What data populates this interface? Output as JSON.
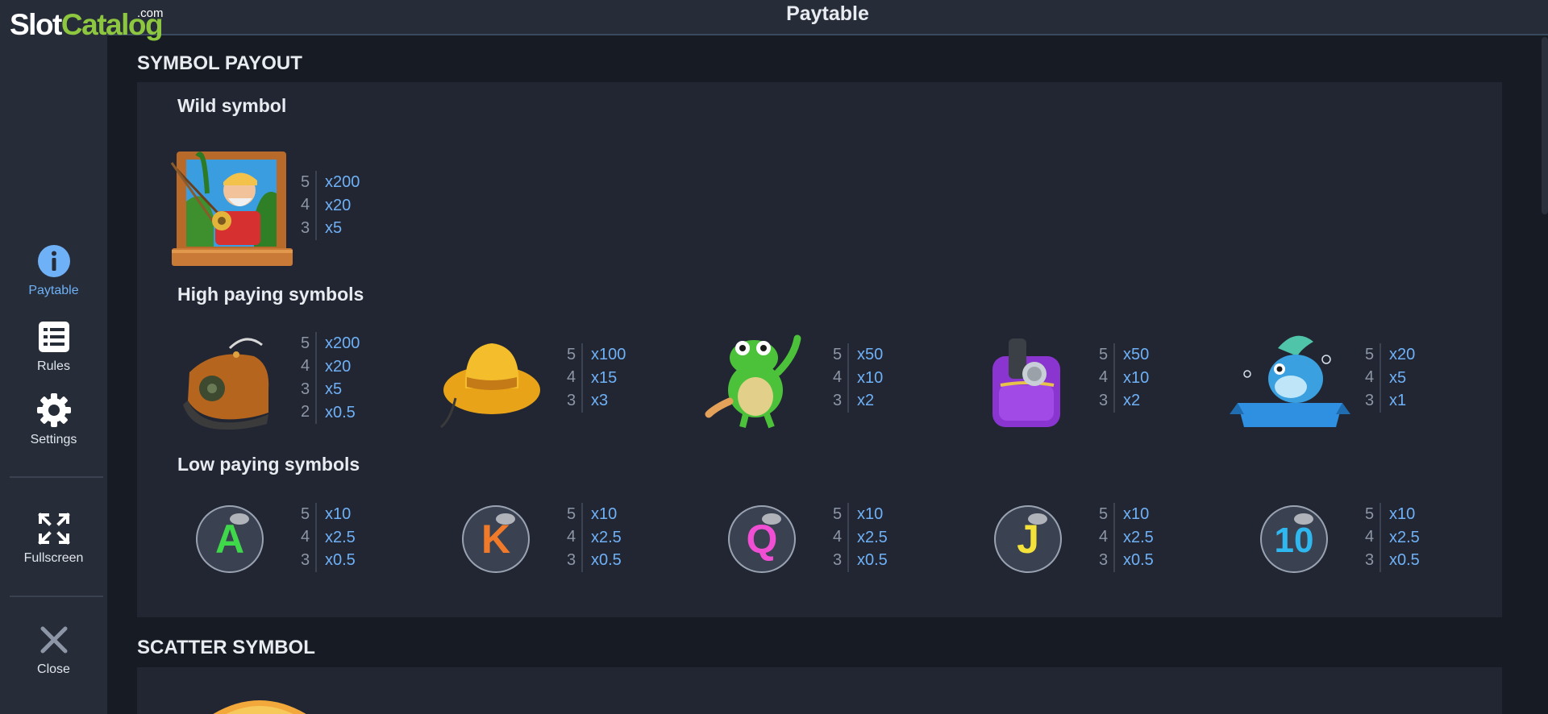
{
  "logo": {
    "part1": "Slot",
    "part2": "Catalog",
    "suffix": ".com"
  },
  "header": {
    "title": "Paytable"
  },
  "sidebar": {
    "items": [
      {
        "label": "Paytable",
        "icon": "info-icon",
        "active": true
      },
      {
        "label": "Rules",
        "icon": "list-icon"
      },
      {
        "label": "Settings",
        "icon": "gear-icon"
      },
      {
        "label": "Fullscreen",
        "icon": "fullscreen-icon"
      },
      {
        "label": "Close",
        "icon": "close-icon"
      }
    ]
  },
  "symbol_payout": {
    "heading": "SYMBOL PAYOUT",
    "wild": {
      "title": "Wild symbol",
      "symbol": {
        "icon": "fisherman-icon",
        "pays": [
          [
            "5",
            "x200"
          ],
          [
            "4",
            "x20"
          ],
          [
            "3",
            "x5"
          ]
        ]
      }
    },
    "high": {
      "title": "High paying symbols",
      "symbols": [
        {
          "icon": "boot-icon",
          "pays": [
            [
              "5",
              "x200"
            ],
            [
              "4",
              "x20"
            ],
            [
              "3",
              "x5"
            ],
            [
              "2",
              "x0.5"
            ]
          ]
        },
        {
          "icon": "hat-icon",
          "pays": [
            [
              "5",
              "x100"
            ],
            [
              "4",
              "x15"
            ],
            [
              "3",
              "x3"
            ]
          ]
        },
        {
          "icon": "frog-icon",
          "pays": [
            [
              "5",
              "x50"
            ],
            [
              "4",
              "x10"
            ],
            [
              "3",
              "x2"
            ]
          ]
        },
        {
          "icon": "backpack-icon",
          "pays": [
            [
              "5",
              "x50"
            ],
            [
              "4",
              "x10"
            ],
            [
              "3",
              "x2"
            ]
          ]
        },
        {
          "icon": "fish-icon",
          "pays": [
            [
              "5",
              "x20"
            ],
            [
              "4",
              "x5"
            ],
            [
              "3",
              "x1"
            ]
          ]
        }
      ]
    },
    "low": {
      "title": "Low paying symbols",
      "symbols": [
        {
          "letter": "A",
          "icon": "letter-a-bubble-icon",
          "color": "#3fd84a",
          "pays": [
            [
              "5",
              "x10"
            ],
            [
              "4",
              "x2.5"
            ],
            [
              "3",
              "x0.5"
            ]
          ]
        },
        {
          "letter": "K",
          "icon": "letter-k-bubble-icon",
          "color": "#f07a2a",
          "pays": [
            [
              "5",
              "x10"
            ],
            [
              "4",
              "x2.5"
            ],
            [
              "3",
              "x0.5"
            ]
          ]
        },
        {
          "letter": "Q",
          "icon": "letter-q-bubble-icon",
          "color": "#f04fd4",
          "pays": [
            [
              "5",
              "x10"
            ],
            [
              "4",
              "x2.5"
            ],
            [
              "3",
              "x0.5"
            ]
          ]
        },
        {
          "letter": "J",
          "icon": "letter-j-bubble-icon",
          "color": "#f4e23a",
          "pays": [
            [
              "5",
              "x10"
            ],
            [
              "4",
              "x2.5"
            ],
            [
              "3",
              "x0.5"
            ]
          ]
        },
        {
          "letter": "10",
          "icon": "letter-10-bubble-icon",
          "color": "#2fb8f0",
          "pays": [
            [
              "5",
              "x10"
            ],
            [
              "4",
              "x2.5"
            ],
            [
              "3",
              "x0.5"
            ]
          ]
        }
      ]
    }
  },
  "scatter": {
    "heading": "SCATTER SYMBOL",
    "icon": "scatter-icon"
  },
  "colors": {
    "accent": "#6fb1f7",
    "panel": "#222632",
    "background": "#171b24",
    "sidebar": "#262c38"
  }
}
